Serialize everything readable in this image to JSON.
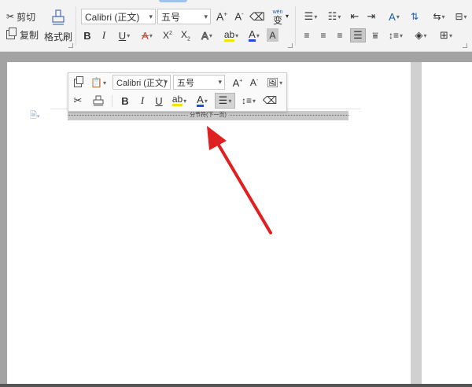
{
  "ribbon": {
    "clipboard": {
      "cut_label": "剪切",
      "copy_label": "复制",
      "format_painter_label": "格式刷"
    },
    "font": {
      "font_name": "Calibri (正文)",
      "font_size": "五号",
      "phonetic_top": "wén",
      "phonetic_bottom": "变"
    }
  },
  "mini_toolbar": {
    "font_name": "Calibri (正文)",
    "font_size": "五号"
  },
  "document": {
    "section_break_label": "分节符(下一页)"
  },
  "colors": {
    "ribbon_bg": "#f3f3f3",
    "workspace_bg": "#a3a3a3",
    "highlight_yellow": "#f5e400",
    "font_color_blue": "#1f4fd6",
    "arrow_red": "#e02020"
  },
  "icons": [
    "cut-icon",
    "copy-icon",
    "format-painter-icon",
    "bold-icon",
    "italic-icon",
    "underline-icon",
    "strikethrough-icon",
    "superscript-icon",
    "subscript-icon",
    "text-effect-icon",
    "highlight-icon",
    "font-color-icon",
    "char-shading-icon",
    "bullets-icon",
    "numbering-icon",
    "align-left-icon",
    "align-center-icon",
    "align-right-icon",
    "justify-icon",
    "distributed-icon",
    "line-spacing-icon",
    "shading-icon",
    "borders-icon",
    "sort-icon",
    "show-marks-icon",
    "paste-icon",
    "styles-icon",
    "red-arrow-annotation"
  ]
}
